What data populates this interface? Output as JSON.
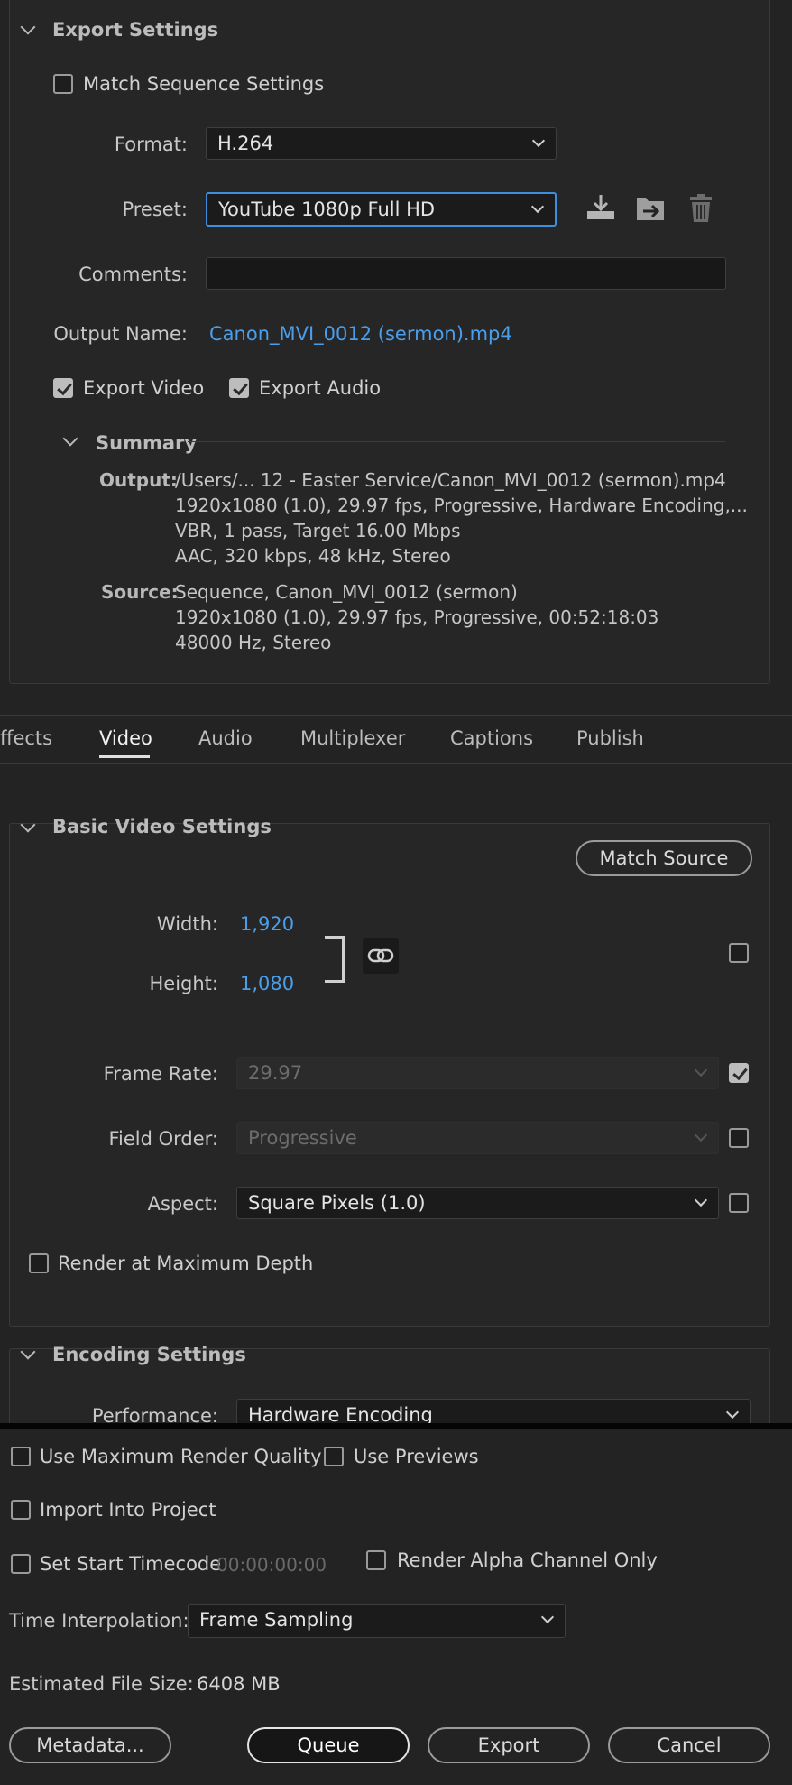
{
  "export_settings": {
    "title": "Export Settings",
    "match_sequence_label": "Match Sequence Settings",
    "match_sequence_checked": false,
    "format_label": "Format:",
    "format_value": "H.264",
    "preset_label": "Preset:",
    "preset_value": "YouTube 1080p Full HD",
    "comments_label": "Comments:",
    "comments_value": "",
    "output_name_label": "Output Name:",
    "output_name_value": "Canon_MVI_0012 (sermon).mp4",
    "export_video_label": "Export Video",
    "export_video_checked": true,
    "export_audio_label": "Export Audio",
    "export_audio_checked": true,
    "icons": [
      "save-preset-icon",
      "import-preset-icon",
      "delete-preset-icon"
    ]
  },
  "summary": {
    "title": "Summary",
    "output_label": "Output:",
    "output_lines": [
      "/Users/... 12 - Easter Service/Canon_MVI_0012 (sermon).mp4",
      "1920x1080 (1.0), 29.97 fps, Progressive, Hardware Encoding,...",
      "VBR, 1 pass, Target 16.00 Mbps",
      "AAC, 320 kbps, 48 kHz, Stereo"
    ],
    "source_label": "Source:",
    "source_lines": [
      "Sequence, Canon_MVI_0012 (sermon)",
      "1920x1080 (1.0), 29.97 fps, Progressive, 00:52:18:03",
      "48000 Hz, Stereo"
    ]
  },
  "tabs": [
    {
      "label": "ffects",
      "active": false
    },
    {
      "label": "Video",
      "active": true
    },
    {
      "label": "Audio",
      "active": false
    },
    {
      "label": "Multiplexer",
      "active": false
    },
    {
      "label": "Captions",
      "active": false
    },
    {
      "label": "Publish",
      "active": false
    }
  ],
  "basic_video": {
    "title": "Basic Video Settings",
    "match_source_label": "Match Source",
    "width_label": "Width:",
    "width_value": "1,920",
    "height_label": "Height:",
    "height_value": "1,080",
    "frame_rate_label": "Frame Rate:",
    "frame_rate_value": "29.97",
    "frame_rate_checked": true,
    "field_order_label": "Field Order:",
    "field_order_value": "Progressive",
    "field_order_checked": false,
    "aspect_label": "Aspect:",
    "aspect_value": "Square Pixels (1.0)",
    "aspect_checked": false,
    "render_max_depth_label": "Render at Maximum Depth",
    "render_max_depth_checked": false,
    "dimension_override_checked": false
  },
  "encoding": {
    "title": "Encoding Settings",
    "performance_label": "Performance:",
    "performance_value": "Hardware Encoding"
  },
  "bottom": {
    "max_render_quality_label": "Use Maximum Render Quality",
    "use_previews_label": "Use Previews",
    "import_into_project_label": "Import Into Project",
    "set_start_timecode_label": "Set Start Timecode",
    "start_timecode_value": "00:00:00:00",
    "render_alpha_label": "Render Alpha Channel Only",
    "time_interp_label": "Time Interpolation:",
    "time_interp_value": "Frame Sampling",
    "est_size_label": "Estimated File Size:",
    "est_size_value": "6408 MB",
    "metadata_label": "Metadata...",
    "queue_label": "Queue",
    "export_label": "Export",
    "cancel_label": "Cancel"
  },
  "colors": {
    "accent_blue": "#4a9eea",
    "focus_blue": "#3f8de0",
    "background": "#232323"
  }
}
